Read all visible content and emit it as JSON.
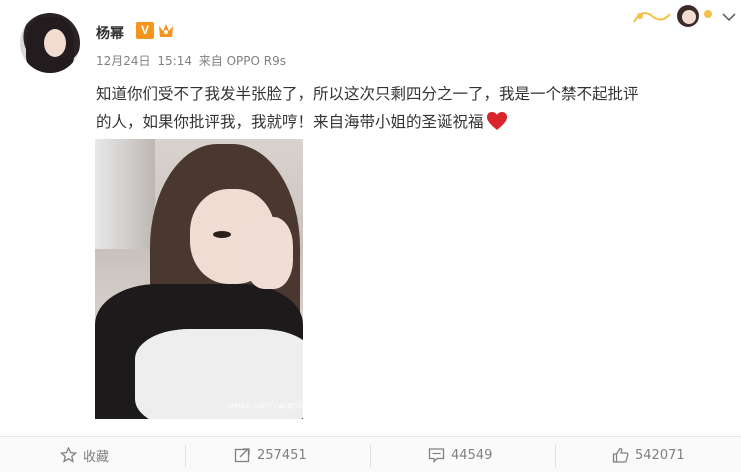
{
  "author": {
    "name": "杨幂",
    "verified_badge": "V"
  },
  "post": {
    "date": "12月24日",
    "time": "15:14",
    "source": "来自 OPPO R9s",
    "text_line1": "知道你们受不了我发半张脸了，所以这次只剩四分之一了，我是一个禁不起批评",
    "text_line2": "的人，如果你批评我，我就哼！来自海带小姐的圣诞祝福",
    "image_watermark": "weibo.com/yangmiblog"
  },
  "actions": {
    "favorite_label": "收藏",
    "repost_count": "257451",
    "comment_count": "44549",
    "like_count": "542071"
  },
  "colors": {
    "accent_orange": "#f7941d",
    "text_gray": "#808080",
    "heart_red": "#d9242b"
  }
}
